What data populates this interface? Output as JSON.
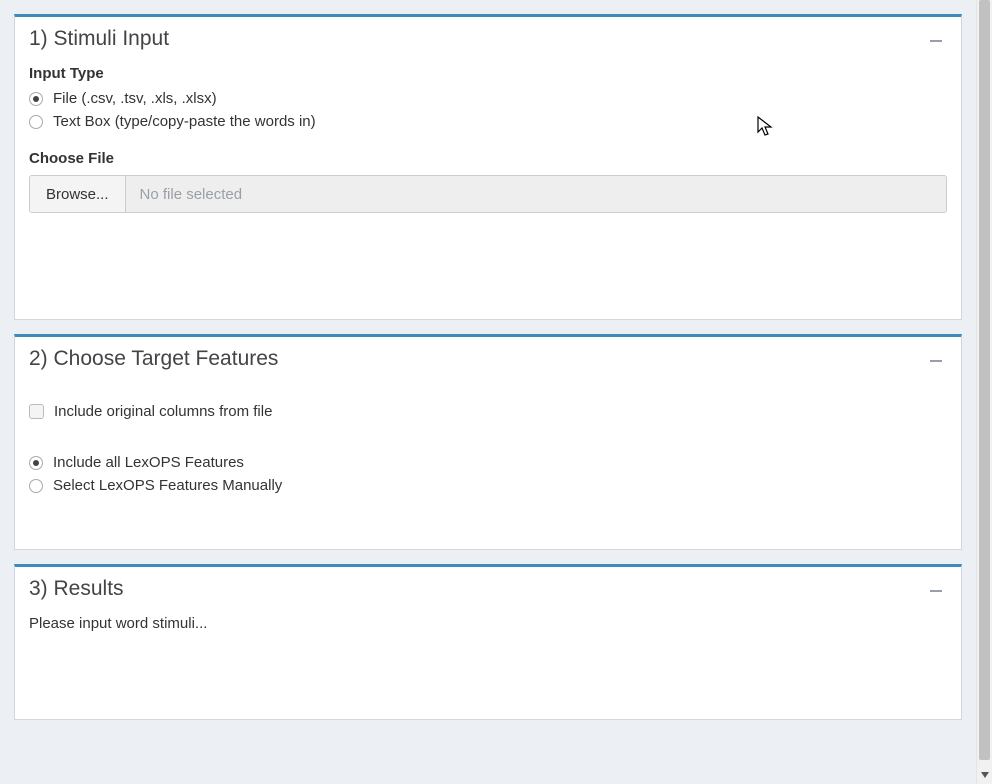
{
  "panel1": {
    "title": "1) Stimuli Input",
    "input_type_label": "Input Type",
    "radio_file": "File (.csv, .tsv, .xls, .xlsx)",
    "radio_textbox": "Text Box (type/copy-paste the words in)",
    "choose_file_label": "Choose File",
    "browse_label": "Browse...",
    "file_placeholder": "No file selected"
  },
  "panel2": {
    "title": "2) Choose Target Features",
    "check_include_original": "Include original columns from file",
    "radio_include_all": "Include all LexOPS Features",
    "radio_select_manually": "Select LexOPS Features Manually"
  },
  "panel3": {
    "title": "3) Results",
    "message": "Please input word stimuli..."
  }
}
